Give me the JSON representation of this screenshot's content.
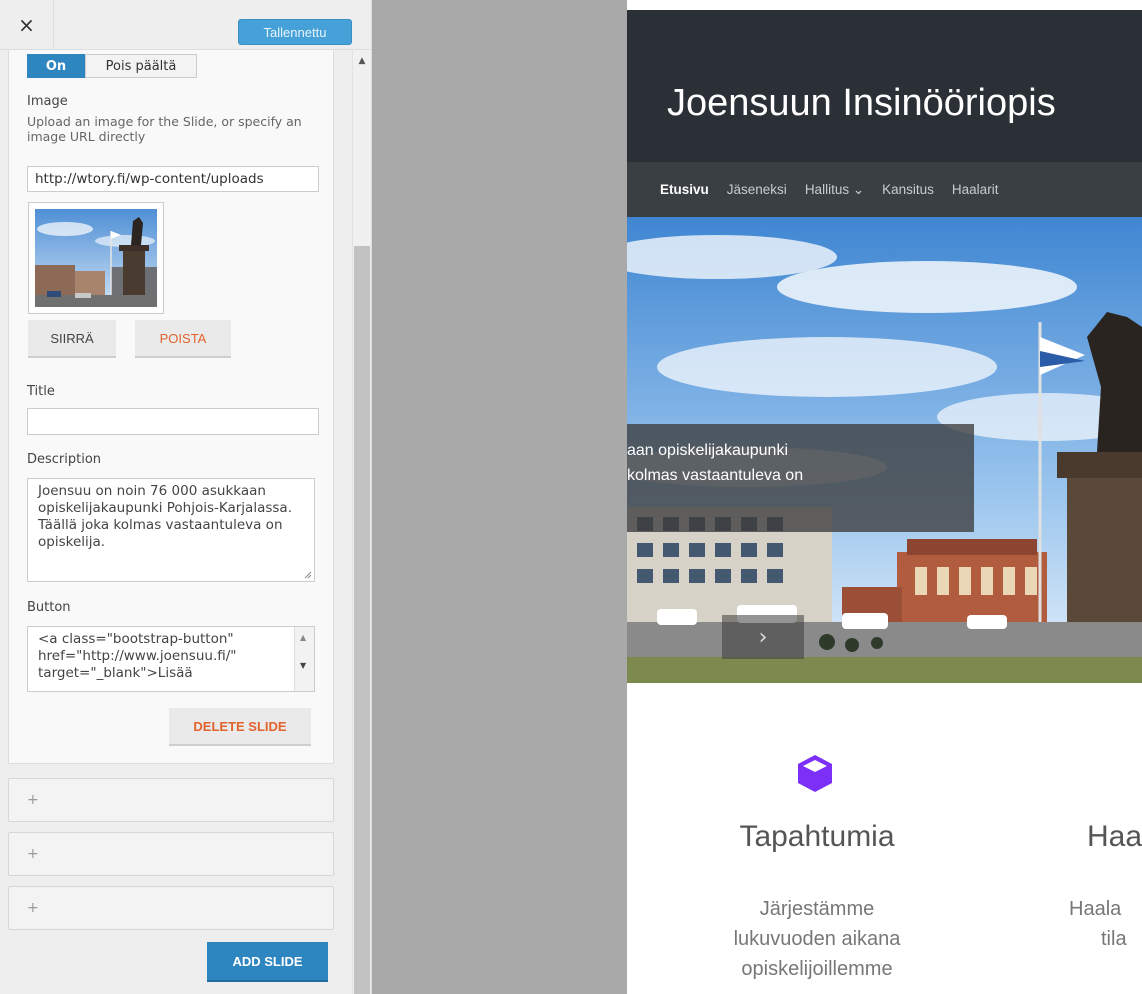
{
  "panel": {
    "close_label": "×",
    "save_label": "Tallennettu",
    "toggle": {
      "on_label": "On",
      "off_label": "Pois päältä"
    },
    "image": {
      "label": "Image",
      "help": "Upload an image for the Slide, or specify an image URL directly",
      "url_value": "http://wtory.fi/wp-content/uploads",
      "move_label": "SIIRRÄ",
      "remove_label": "POISTA"
    },
    "title": {
      "label": "Title",
      "value": ""
    },
    "description": {
      "label": "Description",
      "value": "Joensuu on noin 76 000 asukkaan opiskelijakaupunki Pohjois-Karjalassa. Täällä joka kolmas vastaantuleva on opiskelija."
    },
    "button": {
      "label": "Button",
      "value": "<a class=\"bootstrap-button\" href=\"http://www.joensuu.fi/\" target=\"_blank\">Lisää"
    },
    "delete_label": "DELETE SLIDE",
    "collapsed_slides": [
      "+",
      "+",
      "+"
    ],
    "add_label": "ADD SLIDE"
  },
  "site": {
    "title": "Joensuun Insinööriopis",
    "nav": [
      {
        "label": "Etusivu",
        "active": true
      },
      {
        "label": "Jäseneksi"
      },
      {
        "label": "Hallitus ⌄"
      },
      {
        "label": "Kansitus"
      },
      {
        "label": "Haalarit"
      }
    ],
    "caption_line1": "aan opiskelijakaupunki",
    "caption_line2": "kolmas vastaantuleva on",
    "caption_arrow": "›",
    "feature1": {
      "icon": "cube-icon",
      "title": "Tapahtumia",
      "text": [
        "Järjestämme",
        "lukuvuoden aikana",
        "opiskelijoillemme"
      ]
    },
    "feature2": {
      "title": "Haa",
      "text": [
        "Haala",
        "tila"
      ]
    }
  },
  "colors": {
    "accent": "#2e86c1",
    "danger": "#e2632e",
    "header": "#2a3036",
    "icon": "#7b2ff7"
  }
}
